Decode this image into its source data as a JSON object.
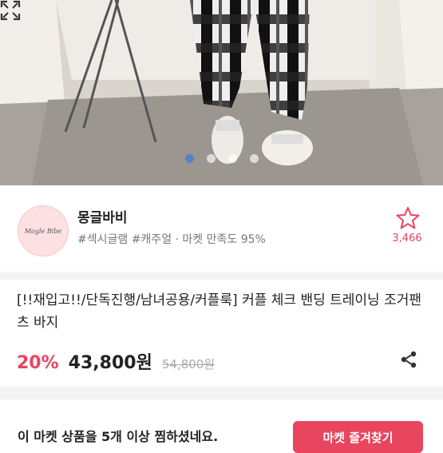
{
  "carousel": {
    "slide_count": 4,
    "active_index": 0
  },
  "shop": {
    "logo_text": "Mogle Bibe",
    "name": "몽글바비",
    "tags": "#섹시글램 #캐주얼 · 마켓 만족도 95%",
    "favorite_count": "3,466"
  },
  "product": {
    "title": "[!!재입고!!/단독진행/남녀공용/커플룩] 커플 체크 밴딩 트레이닝 조거팬츠 바지",
    "discount": "20%",
    "price": "43,800원",
    "original_price": "54,800원"
  },
  "notice": "이 마켓 상품을 5개 이상 찜하셨네요.",
  "cta_label": "마켓 즐겨찾기",
  "colors": {
    "accent": "#e9455f",
    "active_dot": "#5a7fc8"
  }
}
